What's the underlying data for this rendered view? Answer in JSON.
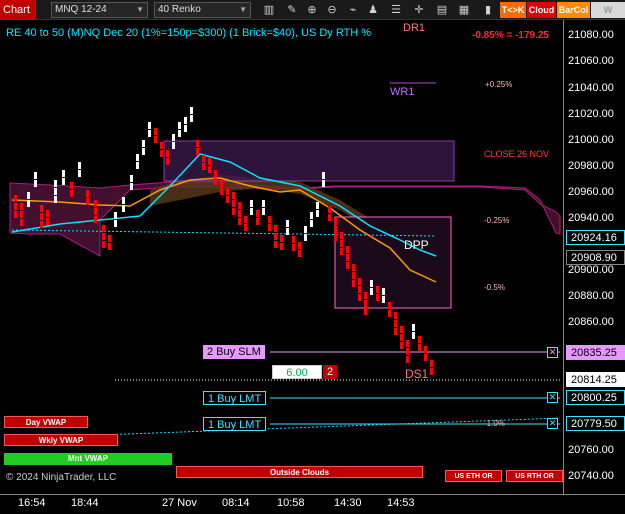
{
  "toolbar": {
    "chart_label": "Chart",
    "instrument": "MNQ 12-24",
    "bar_type": "40 Renko",
    "tags": [
      {
        "label": "T<>K",
        "bg": "#ff6a00",
        "fg": "#ffffff"
      },
      {
        "label": "Cloud",
        "bg": "#e00000",
        "fg": "#ffffff"
      },
      {
        "label": "BarCol",
        "bg": "#ff8c00",
        "fg": "#ffffff"
      },
      {
        "label": "W VWAP",
        "bg": "#d9d9d9",
        "fg": "#9a9a9a"
      }
    ],
    "icons": [
      "bar-style-icon",
      "drawing-tools-icon",
      "zoom-in-icon",
      "zoom-out-icon",
      "indicators-icon",
      "strategies-icon",
      "properties-icon",
      "crosshair-icon",
      "attach-icon",
      "templates-icon",
      "more-icon"
    ]
  },
  "header": {
    "title": "RE 40 to 50 (M)NQ Dec 20 (1%=150p=$300) (1 Brick=$40), US Dy RTH %",
    "change": "-0.85% = -179.25"
  },
  "levels": {
    "dr1": "DR1",
    "wr1": "WR1",
    "plus_025": "+0.25%",
    "close_label": "CLOSE 26 NOV",
    "minus_025": "-0.25%",
    "dpp": "DPP",
    "minus_05": "-0.5%",
    "ds1": "DS1",
    "minus_1": "-1.0%"
  },
  "price_axis": {
    "ticks": [
      "21080.00",
      "21060.00",
      "21040.00",
      "21020.00",
      "21000.00",
      "20980.00",
      "20960.00",
      "20940.00",
      "20900.00",
      "20880.00",
      "20860.00",
      "20760.00",
      "20740.00"
    ],
    "tags": [
      {
        "value": "20924.16",
        "bg": "#000000",
        "fg": "#ffffff",
        "border": "#40e0ff"
      },
      {
        "value": "20908.90",
        "bg": "#000000",
        "fg": "#ffffff",
        "border": "#888888"
      },
      {
        "value": "20835.25",
        "bg": "#e699ff",
        "fg": "#000000",
        "border": "#e699ff"
      },
      {
        "value": "20814.25",
        "bg": "#ffffff",
        "fg": "#000000",
        "border": "#ffffff"
      },
      {
        "value": "20800.25",
        "bg": "#000000",
        "fg": "#ffffff",
        "border": "#40e0ff"
      },
      {
        "value": "20779.50",
        "bg": "#000000",
        "fg": "#ffffff",
        "border": "#40e0ff"
      }
    ]
  },
  "time_axis": [
    "16:54",
    "18:44",
    "27 Nov",
    "08:14",
    "10:58",
    "14:30",
    "14:53"
  ],
  "orders": {
    "stop": {
      "label": "2 Buy SLM",
      "bg": "#e699ff"
    },
    "entry_qty_value": "6.00",
    "entry_qty_count": "2",
    "limit1": {
      "label": "1 Buy LMT"
    },
    "limit2": {
      "label": "1 Buy LMT"
    },
    "close_icon": "close-icon"
  },
  "buttons": {
    "day_vwap": "Day VWAP",
    "wkly_vwap": "Wkly VWAP",
    "mnt_vwap": "Mnt VWAP",
    "outside_clouds": "Outside Clouds",
    "us_eth_or": "US ETH OR",
    "us_rth_or": "US RTH OR"
  },
  "copyright": "© 2024 NinjaTrader, LLC",
  "colors": {
    "up_brick": "#ffffff",
    "down_brick": "#ff0000",
    "cloud_fill": "#5a1a3a",
    "accent_cyan": "#00e5ff",
    "orange": "#ff9900"
  }
}
